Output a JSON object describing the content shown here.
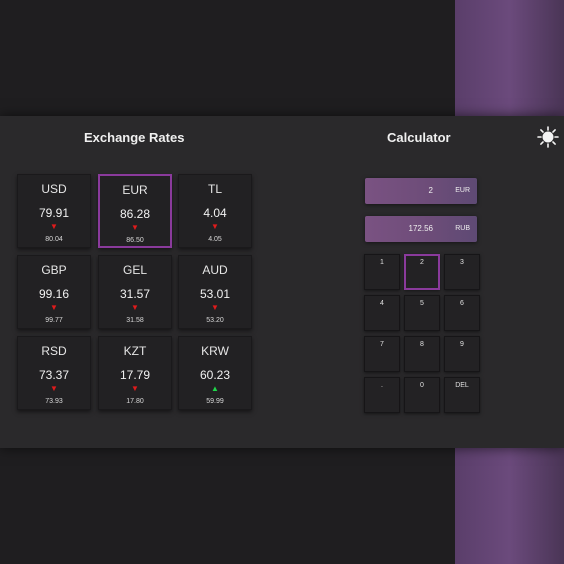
{
  "rates_title": "Exchange Rates",
  "calc_title": "Calculator",
  "theme_icon": "sun-icon",
  "colors": {
    "down": "#e01b1b",
    "up": "#1fd64a",
    "accent": "#8a3a9c"
  },
  "currencies": [
    {
      "code": "USD",
      "rate": "79.91",
      "trend": "down",
      "prev": "80.04"
    },
    {
      "code": "EUR",
      "rate": "86.28",
      "trend": "down",
      "prev": "86.50"
    },
    {
      "code": "TL",
      "rate": "4.04",
      "trend": "down",
      "prev": "4.05"
    },
    {
      "code": "GBP",
      "rate": "99.16",
      "trend": "down",
      "prev": "99.77"
    },
    {
      "code": "GEL",
      "rate": "31.57",
      "trend": "down",
      "prev": "31.58"
    },
    {
      "code": "AUD",
      "rate": "53.01",
      "trend": "down",
      "prev": "53.20"
    },
    {
      "code": "RSD",
      "rate": "73.37",
      "trend": "down",
      "prev": "73.93"
    },
    {
      "code": "KZT",
      "rate": "17.79",
      "trend": "down",
      "prev": "17.80"
    },
    {
      "code": "KRW",
      "rate": "60.23",
      "trend": "up",
      "prev": "59.99"
    }
  ],
  "selected_currency": "EUR",
  "calculator": {
    "input_value": "2",
    "input_currency": "EUR",
    "output_value": "172.56",
    "output_currency": "RUB",
    "keys": [
      "1",
      "2",
      "3",
      "4",
      "5",
      "6",
      "7",
      "8",
      "9",
      ".",
      "0",
      "DEL"
    ],
    "selected_key": "2"
  }
}
